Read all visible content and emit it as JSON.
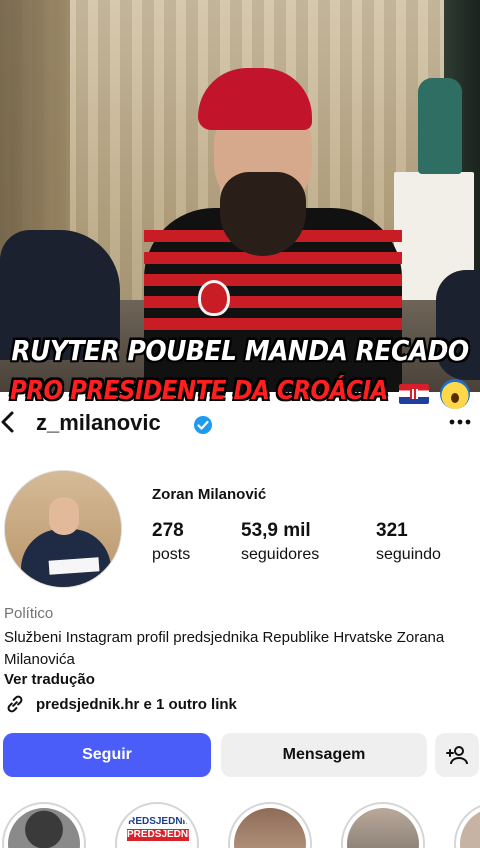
{
  "video": {
    "headline_line1": "RUYTER POUBEL MANDA RECADO",
    "headline_line2": "PRO PRESIDENTE DA CROÁCIA",
    "flag_icon": "croatia-flag-icon",
    "emoji_icon": "face-screaming-emoji-icon"
  },
  "profile": {
    "username": "z_milanovic",
    "verified": true,
    "full_name": "Zoran Milanović",
    "stats": [
      {
        "value": "278",
        "label": "posts"
      },
      {
        "value": "53,9 mil",
        "label": "seguidores"
      },
      {
        "value": "321",
        "label": "seguindo"
      }
    ],
    "category": "Político",
    "bio": "Službeni Instagram profil predsjednika Republike Hrvatske Zorana Milanovića",
    "translate_label": "Ver tradução",
    "link_text": "predsjednik.hr e 1 outro link",
    "buttons": {
      "follow": "Seguir",
      "message": "Mensagem"
    },
    "highlights": [
      {
        "text": ""
      },
      {
        "text": "PREDSJEDNIK",
        "badge": "PREDSJEDNIKA"
      },
      {
        "text": ""
      },
      {
        "text": ""
      }
    ]
  },
  "colors": {
    "follow_button": "#4a5df9",
    "secondary_button": "#efefef",
    "verified_badge": "#1d9bf0",
    "headline_red": "#ff1f1f"
  }
}
